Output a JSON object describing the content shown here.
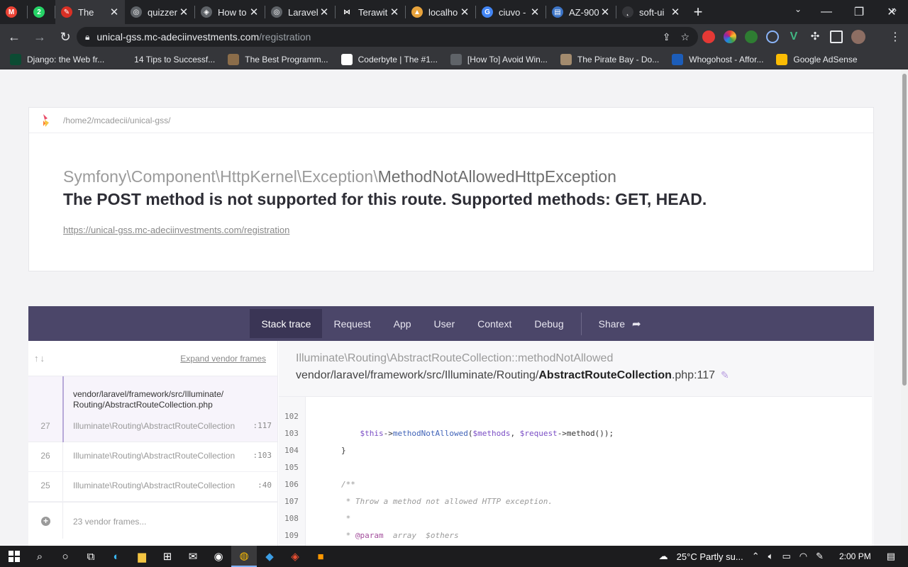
{
  "browser": {
    "tabs": [
      {
        "title": "",
        "favicon_color": "#ea4335",
        "favicon_glyph": "M",
        "favicon": "gmail-icon"
      },
      {
        "title": "",
        "favicon_color": "#25d366",
        "favicon_glyph": "2",
        "favicon": "whatsapp-icon"
      },
      {
        "title": "The",
        "favicon_color": "#d93025",
        "favicon_glyph": "✎",
        "favicon": "error-page-icon",
        "active": true
      },
      {
        "title": "quizzer",
        "favicon_color": "#5f6368",
        "favicon_glyph": "◎",
        "favicon": "globe-icon"
      },
      {
        "title": "How to",
        "favicon_color": "#5f6368",
        "favicon_glyph": "◈",
        "favicon": "codepen-icon"
      },
      {
        "title": "Laravel",
        "favicon_color": "#5f6368",
        "favicon_glyph": "◎",
        "favicon": "globe-icon"
      },
      {
        "title": "Terawit",
        "favicon_color": "#202124",
        "favicon_glyph": "⋈",
        "favicon": "terawit-icon"
      },
      {
        "title": "localho",
        "favicon_color": "#e8a33c",
        "favicon_glyph": "▲",
        "favicon": "phpmyadmin-icon"
      },
      {
        "title": "ciuvo -",
        "favicon_color": "#4285f4",
        "favicon_glyph": "G",
        "favicon": "google-icon"
      },
      {
        "title": "AZ-900",
        "favicon_color": "#3c74c6",
        "favicon_glyph": "▤",
        "favicon": "doc-icon"
      },
      {
        "title": "soft-ui",
        "favicon_color": "#35363a",
        "favicon_glyph": "˛",
        "favicon": "soft-ui-icon"
      }
    ],
    "url_host": "unical-gss.mc-adeciinvestments.com",
    "url_path": "/registration",
    "bookmarks": [
      {
        "label": "Django: the Web fr...",
        "color": "#0c4b33",
        "icon": "django-icon"
      },
      {
        "label": "14 Tips to Successf...",
        "color": "#35363a",
        "icon": "blank-icon"
      },
      {
        "label": "The Best Programm...",
        "color": "#8b6d4a",
        "icon": "image-icon"
      },
      {
        "label": "Coderbyte | The #1...",
        "color": "#ffffff",
        "icon": "coderbyte-icon"
      },
      {
        "label": "[How To] Avoid Win...",
        "color": "#5f6368",
        "icon": "tool-icon"
      },
      {
        "label": "The Pirate Bay - Do...",
        "color": "#a38b6e",
        "icon": "pirate-icon"
      },
      {
        "label": "Whogohost - Affor...",
        "color": "#1c5db9",
        "icon": "whogohost-icon"
      },
      {
        "label": "Google AdSense",
        "color": "#fbbc04",
        "icon": "adsense-icon"
      }
    ]
  },
  "error_page": {
    "app_path": "/home2/mcadecii/unical-gss/",
    "exception_namespace": "Symfony\\Component\\HttpKernel\\Exception\\",
    "exception_class": "MethodNotAllowedHttpException",
    "message": "The POST method is not supported for this route. Supported methods: GET, HEAD.",
    "url": "https://unical-gss.mc-adeciinvestments.com/registration",
    "tabs": [
      "Stack trace",
      "Request",
      "App",
      "User",
      "Context",
      "Debug"
    ],
    "share_label": "Share",
    "expand_vendor": "Expand vendor frames",
    "selected_frame_file": "vendor/laravel/framework/src/Illuminate/\nRouting/AbstractRouteCollection.php",
    "frames": [
      {
        "num": "27",
        "cls": "Illuminate\\Routing\\AbstractRouteCollection",
        "line": ":117"
      },
      {
        "num": "26",
        "cls": "Illuminate\\Routing\\AbstractRouteCollection",
        "line": ":103"
      },
      {
        "num": "25",
        "cls": "Illuminate\\Routing\\AbstractRouteCollection",
        "line": ":40"
      }
    ],
    "vendor_frames": "23 vendor frames...",
    "detail_class": "Illuminate\\Routing\\AbstractRouteCollection::methodNotAllowed",
    "detail_file_prefix": "vendor/laravel/framework/src/Illuminate/Routing/",
    "detail_file_name": "AbstractRouteCollection",
    "detail_file_suffix": ".php:117",
    "code_lines": [
      {
        "n": "102",
        "html": ""
      },
      {
        "n": "103",
        "html": "    <span class=\"v\">$this</span>-><span class=\"m\">methodNotAllowed</span>(<span class=\"v\">$methods</span>, <span class=\"v\">$request</span>->method());"
      },
      {
        "n": "104",
        "html": "}"
      },
      {
        "n": "105",
        "html": ""
      },
      {
        "n": "106",
        "html": "<span class=\"c\">/**</span>"
      },
      {
        "n": "107",
        "html": "<span class=\"c\"> * Throw a method not allowed HTTP exception.</span>"
      },
      {
        "n": "108",
        "html": "<span class=\"c\"> *</span>"
      },
      {
        "n": "109",
        "html": "<span class=\"c\"> * </span><span class=\"t\">@param</span><span class=\"c\">  array  $others</span>"
      }
    ]
  },
  "taskbar": {
    "weather": "25°C  Partly su...",
    "time": "2:00 PM"
  }
}
